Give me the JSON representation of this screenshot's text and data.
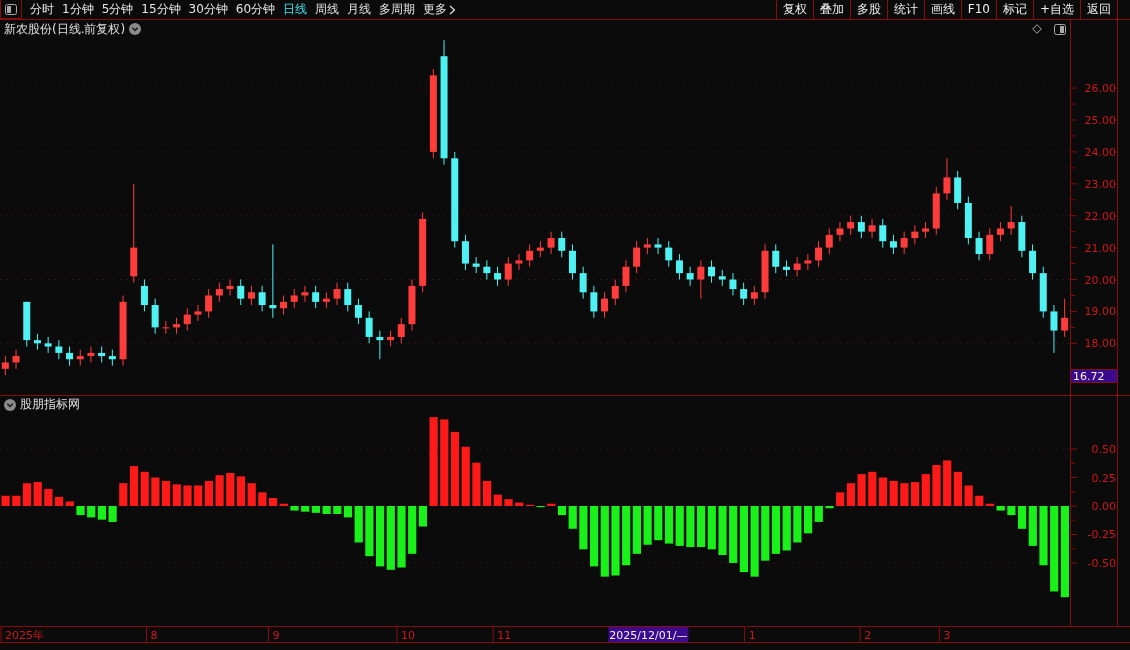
{
  "toolbar": {
    "tabs": [
      {
        "label": "分时",
        "selected": false,
        "kind": "period"
      },
      {
        "label": "1分钟",
        "selected": false,
        "kind": "period"
      },
      {
        "label": "5分钟",
        "selected": false,
        "kind": "period"
      },
      {
        "label": "15分钟",
        "selected": false,
        "kind": "period"
      },
      {
        "label": "30分钟",
        "selected": false,
        "kind": "period"
      },
      {
        "label": "60分钟",
        "selected": false,
        "kind": "period"
      },
      {
        "label": "日线",
        "selected": true,
        "kind": "period"
      },
      {
        "label": "周线",
        "selected": false,
        "kind": "period"
      },
      {
        "label": "月线",
        "selected": false,
        "kind": "period"
      },
      {
        "label": "多周期",
        "selected": false,
        "kind": "period"
      },
      {
        "label": "更多",
        "selected": false,
        "kind": "menu"
      }
    ],
    "buttons": [
      "复权",
      "叠加",
      "多股",
      "统计",
      "画线",
      "F10",
      "标记",
      "+自选",
      "返回"
    ]
  },
  "price_panel": {
    "title": "新农股份(日线.前复权)",
    "current_price": "16.72",
    "chart_data": {
      "type": "candlestick",
      "ylim": [
        16.38,
        27.57
      ],
      "grid": true,
      "yticks": [
        {
          "value": 26,
          "label": "26.00"
        },
        {
          "value": 25,
          "label": "25.00"
        },
        {
          "value": 24,
          "label": "24.00"
        },
        {
          "value": 23,
          "label": "23.00"
        },
        {
          "value": 22,
          "label": "22.00"
        },
        {
          "value": 21,
          "label": "21.00"
        },
        {
          "value": 20,
          "label": "20.00"
        },
        {
          "value": 19,
          "label": "19.00"
        },
        {
          "value": 18,
          "label": "18.00"
        }
      ],
      "ohlc": [
        [
          17.2,
          17.6,
          17.0,
          17.4
        ],
        [
          17.4,
          17.8,
          17.2,
          17.6
        ],
        [
          19.3,
          19.3,
          17.9,
          18.1
        ],
        [
          18.1,
          18.3,
          17.8,
          18.0
        ],
        [
          18.0,
          18.2,
          17.7,
          17.9
        ],
        [
          17.9,
          18.1,
          17.5,
          17.7
        ],
        [
          17.7,
          17.9,
          17.3,
          17.5
        ],
        [
          17.5,
          17.8,
          17.3,
          17.6
        ],
        [
          17.6,
          17.9,
          17.4,
          17.7
        ],
        [
          17.7,
          17.9,
          17.4,
          17.6
        ],
        [
          17.6,
          17.8,
          17.3,
          17.5
        ],
        [
          17.5,
          19.5,
          17.3,
          19.3
        ],
        [
          20.1,
          23.0,
          19.9,
          21.0
        ],
        [
          19.8,
          20.0,
          19.0,
          19.2
        ],
        [
          19.2,
          19.4,
          18.3,
          18.5
        ],
        [
          18.5,
          18.7,
          18.3,
          18.5
        ],
        [
          18.5,
          18.8,
          18.3,
          18.6
        ],
        [
          18.6,
          19.1,
          18.4,
          18.9
        ],
        [
          18.9,
          19.2,
          18.7,
          19.0
        ],
        [
          19.0,
          19.7,
          18.8,
          19.5
        ],
        [
          19.5,
          19.9,
          19.3,
          19.7
        ],
        [
          19.7,
          20.0,
          19.5,
          19.8
        ],
        [
          19.8,
          20.0,
          19.2,
          19.4
        ],
        [
          19.4,
          19.8,
          19.2,
          19.6
        ],
        [
          19.6,
          19.8,
          19.0,
          19.2
        ],
        [
          19.2,
          21.1,
          18.8,
          19.1
        ],
        [
          19.1,
          19.5,
          18.9,
          19.3
        ],
        [
          19.3,
          19.7,
          19.1,
          19.5
        ],
        [
          19.5,
          19.8,
          19.3,
          19.6
        ],
        [
          19.6,
          19.8,
          19.1,
          19.3
        ],
        [
          19.3,
          19.6,
          19.1,
          19.4
        ],
        [
          19.4,
          19.9,
          19.2,
          19.7
        ],
        [
          19.7,
          19.9,
          19.0,
          19.2
        ],
        [
          19.2,
          19.4,
          18.6,
          18.8
        ],
        [
          18.8,
          19.0,
          18.0,
          18.2
        ],
        [
          18.2,
          18.4,
          17.5,
          18.1
        ],
        [
          18.1,
          18.4,
          17.9,
          18.2
        ],
        [
          18.2,
          18.8,
          18.0,
          18.6
        ],
        [
          18.6,
          20.0,
          18.4,
          19.8
        ],
        [
          19.8,
          22.1,
          19.6,
          21.9
        ],
        [
          24.0,
          26.6,
          23.8,
          26.4
        ],
        [
          27.0,
          27.5,
          23.6,
          23.8
        ],
        [
          23.8,
          24.0,
          21.0,
          21.2
        ],
        [
          21.2,
          21.4,
          20.3,
          20.5
        ],
        [
          20.5,
          20.7,
          20.2,
          20.4
        ],
        [
          20.4,
          20.6,
          20.0,
          20.2
        ],
        [
          20.2,
          20.4,
          19.8,
          20.0
        ],
        [
          20.0,
          20.7,
          19.8,
          20.5
        ],
        [
          20.5,
          20.8,
          20.3,
          20.6
        ],
        [
          20.6,
          21.1,
          20.4,
          20.9
        ],
        [
          20.9,
          21.2,
          20.7,
          21.0
        ],
        [
          21.0,
          21.5,
          20.8,
          21.3
        ],
        [
          21.3,
          21.5,
          20.7,
          20.9
        ],
        [
          20.9,
          21.1,
          20.0,
          20.2
        ],
        [
          20.2,
          20.4,
          19.4,
          19.6
        ],
        [
          19.6,
          19.8,
          18.8,
          19.0
        ],
        [
          19.0,
          19.6,
          18.8,
          19.4
        ],
        [
          19.4,
          20.0,
          19.2,
          19.8
        ],
        [
          19.8,
          20.6,
          19.6,
          20.4
        ],
        [
          20.4,
          21.2,
          20.2,
          21.0
        ],
        [
          21.0,
          21.3,
          20.8,
          21.1
        ],
        [
          21.1,
          21.3,
          20.8,
          21.0
        ],
        [
          21.0,
          21.2,
          20.4,
          20.6
        ],
        [
          20.6,
          20.8,
          20.0,
          20.2
        ],
        [
          20.2,
          20.4,
          19.8,
          20.0
        ],
        [
          20.0,
          20.6,
          19.4,
          20.4
        ],
        [
          20.4,
          20.6,
          19.9,
          20.1
        ],
        [
          20.1,
          20.3,
          19.8,
          20.0
        ],
        [
          20.0,
          20.2,
          19.5,
          19.7
        ],
        [
          19.7,
          19.9,
          19.2,
          19.4
        ],
        [
          19.4,
          19.8,
          19.2,
          19.6
        ],
        [
          19.6,
          21.1,
          19.4,
          20.9
        ],
        [
          20.9,
          21.1,
          20.2,
          20.4
        ],
        [
          20.4,
          20.6,
          20.1,
          20.3
        ],
        [
          20.3,
          20.7,
          20.1,
          20.5
        ],
        [
          20.5,
          20.8,
          20.3,
          20.6
        ],
        [
          20.6,
          21.2,
          20.4,
          21.0
        ],
        [
          21.0,
          21.6,
          20.8,
          21.4
        ],
        [
          21.4,
          21.8,
          21.2,
          21.6
        ],
        [
          21.6,
          22.0,
          21.4,
          21.8
        ],
        [
          21.8,
          22.0,
          21.3,
          21.5
        ],
        [
          21.5,
          21.9,
          21.3,
          21.7
        ],
        [
          21.7,
          21.9,
          21.0,
          21.2
        ],
        [
          21.2,
          21.4,
          20.8,
          21.0
        ],
        [
          21.0,
          21.5,
          20.8,
          21.3
        ],
        [
          21.3,
          21.7,
          21.1,
          21.5
        ],
        [
          21.5,
          21.8,
          21.3,
          21.6
        ],
        [
          21.6,
          22.9,
          21.4,
          22.7
        ],
        [
          22.7,
          23.8,
          22.5,
          23.2
        ],
        [
          23.2,
          23.4,
          22.2,
          22.4
        ],
        [
          22.4,
          22.6,
          21.1,
          21.3
        ],
        [
          21.3,
          21.5,
          20.6,
          20.8
        ],
        [
          20.8,
          21.6,
          20.6,
          21.4
        ],
        [
          21.4,
          21.8,
          21.2,
          21.6
        ],
        [
          21.6,
          22.3,
          21.4,
          21.8
        ],
        [
          21.8,
          22.0,
          20.7,
          20.9
        ],
        [
          20.9,
          21.1,
          20.0,
          20.2
        ],
        [
          20.2,
          20.4,
          18.8,
          19.0
        ],
        [
          19.0,
          19.2,
          17.7,
          18.4
        ],
        [
          18.4,
          19.4,
          18.2,
          18.8
        ]
      ]
    }
  },
  "indicator_panel": {
    "title": "股朋指标网",
    "chart_data": {
      "type": "bar",
      "ylim": [
        -1.053,
        0.816
      ],
      "grid": true,
      "yticks": [
        {
          "value": 0.5,
          "label": "0.50"
        },
        {
          "value": 0.25,
          "label": "0.25"
        },
        {
          "value": 0,
          "label": "0.00"
        },
        {
          "value": -0.25,
          "label": "-0.25"
        },
        {
          "value": -0.5,
          "label": "-0.50"
        }
      ],
      "values": [
        0.09,
        0.09,
        0.2,
        0.21,
        0.15,
        0.08,
        0.04,
        -0.08,
        -0.1,
        -0.12,
        -0.14,
        0.2,
        0.35,
        0.3,
        0.25,
        0.22,
        0.19,
        0.18,
        0.18,
        0.22,
        0.27,
        0.29,
        0.26,
        0.2,
        0.12,
        0.07,
        0.02,
        -0.04,
        -0.05,
        -0.06,
        -0.07,
        -0.07,
        -0.1,
        -0.32,
        -0.44,
        -0.53,
        -0.56,
        -0.54,
        -0.42,
        -0.18,
        0.78,
        0.76,
        0.65,
        0.52,
        0.38,
        0.22,
        0.1,
        0.06,
        0.03,
        0.01,
        -0.01,
        0.02,
        -0.08,
        -0.2,
        -0.38,
        -0.53,
        -0.62,
        -0.61,
        -0.52,
        -0.42,
        -0.34,
        -0.3,
        -0.33,
        -0.35,
        -0.36,
        -0.36,
        -0.38,
        -0.43,
        -0.5,
        -0.58,
        -0.62,
        -0.48,
        -0.42,
        -0.39,
        -0.32,
        -0.24,
        -0.14,
        -0.02,
        0.12,
        0.2,
        0.28,
        0.3,
        0.25,
        0.22,
        0.2,
        0.21,
        0.28,
        0.36,
        0.4,
        0.3,
        0.18,
        0.09,
        0.02,
        -0.04,
        -0.08,
        -0.2,
        -0.35,
        -0.52,
        -0.75,
        -0.8
      ]
    }
  },
  "x_axis": {
    "labels": [
      "2025年",
      "8",
      "9",
      "10",
      "11",
      "1",
      "2",
      "3"
    ],
    "cursor_date": "2025/12/01/—"
  }
}
